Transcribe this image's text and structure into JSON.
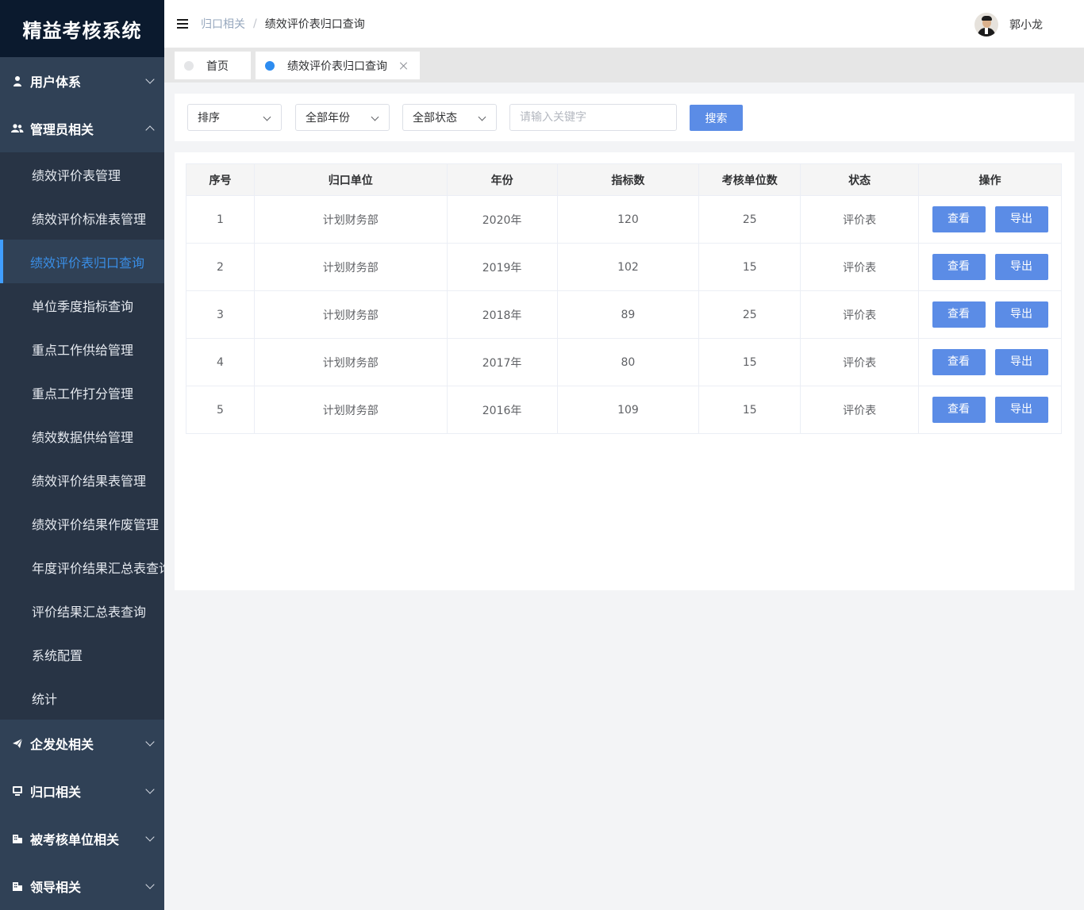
{
  "app": {
    "title": "精益考核系统"
  },
  "sidebar": {
    "groups": [
      {
        "label": "用户体系",
        "icon": "user-icon"
      },
      {
        "label": "管理员相关",
        "icon": "users-icon"
      },
      {
        "label": "企发处相关",
        "icon": "paper-plane-icon"
      },
      {
        "label": "归口相关",
        "icon": "monitor-icon"
      },
      {
        "label": "被考核单位相关",
        "icon": "building-icon"
      },
      {
        "label": "领导相关",
        "icon": "building-icon"
      }
    ],
    "admin_items": [
      "绩效评价表管理",
      "绩效评价标准表管理",
      "绩效评价表归口查询",
      "单位季度指标查询",
      "重点工作供给管理",
      "重点工作打分管理",
      "绩效数据供给管理",
      "绩效评价结果表管理",
      "绩效评价结果作废管理",
      "年度评价结果汇总表查询",
      "评价结果汇总表查询",
      "系统配置",
      "统计"
    ],
    "active_item": "绩效评价表归口查询"
  },
  "header": {
    "breadcrumb": {
      "parent": "归口相关",
      "separator": "/",
      "current": "绩效评价表归口查询"
    },
    "user": {
      "name": "郭小龙"
    }
  },
  "tabs": [
    {
      "label": "首页",
      "active": false
    },
    {
      "label": "绩效评价表归口查询",
      "active": true
    }
  ],
  "filters": {
    "sort": "排序",
    "year": "全部年份",
    "status": "全部状态",
    "keyword_placeholder": "请输入关键字",
    "search_label": "搜索"
  },
  "table": {
    "columns": [
      "序号",
      "归口单位",
      "年份",
      "指标数",
      "考核单位数",
      "状态",
      "操作"
    ],
    "rows": [
      {
        "no": "1",
        "unit": "计划财务部",
        "year": "2020年",
        "indicators": "120",
        "units": "25",
        "status": "评价表"
      },
      {
        "no": "2",
        "unit": "计划财务部",
        "year": "2019年",
        "indicators": "102",
        "units": "15",
        "status": "评价表"
      },
      {
        "no": "3",
        "unit": "计划财务部",
        "year": "2018年",
        "indicators": "89",
        "units": "25",
        "status": "评价表"
      },
      {
        "no": "4",
        "unit": "计划财务部",
        "year": "2017年",
        "indicators": "80",
        "units": "15",
        "status": "评价表"
      },
      {
        "no": "5",
        "unit": "计划财务部",
        "year": "2016年",
        "indicators": "109",
        "units": "15",
        "status": "评价表"
      }
    ],
    "actions": {
      "view": "查看",
      "export": "导出"
    }
  },
  "colors": {
    "sidebar_bg": "#304156",
    "logo_bg": "#0b1a2e",
    "primary": "#5b8ce6",
    "active_text": "#3a8ee6"
  }
}
